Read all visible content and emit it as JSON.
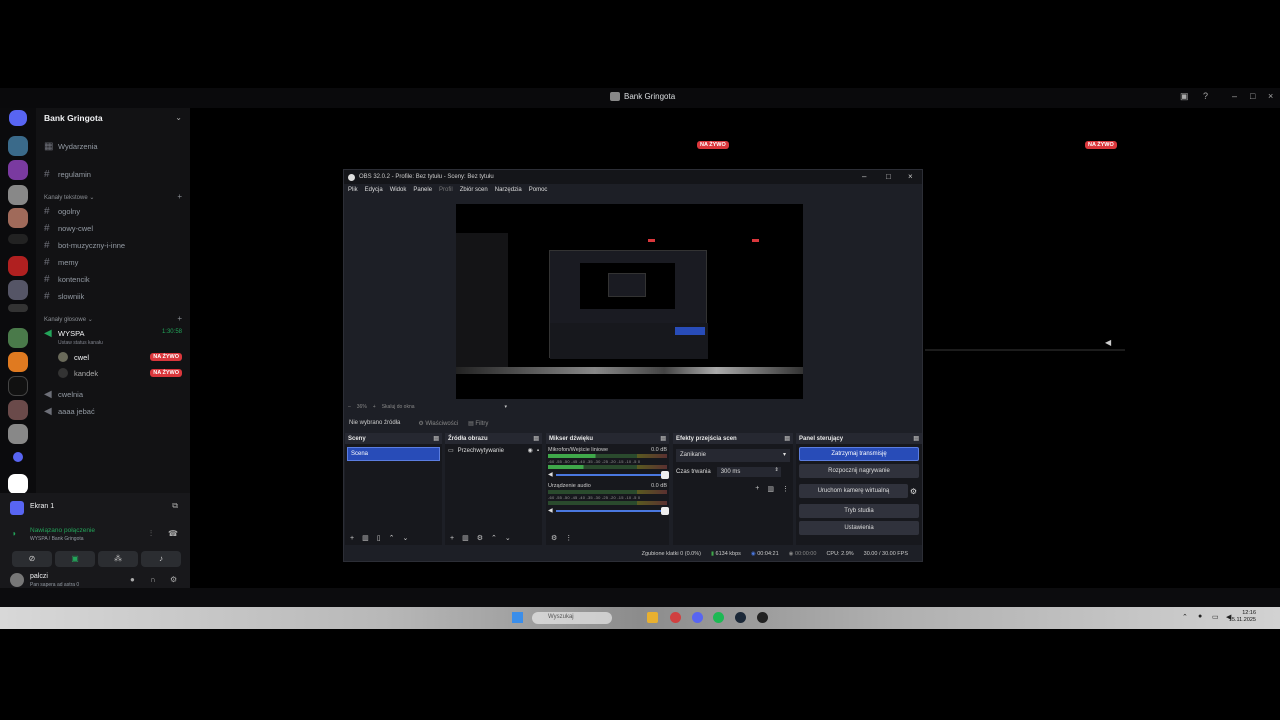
{
  "window": {
    "title": "Bank Gringota"
  },
  "discord": {
    "guild_name": "Bank Gringota",
    "events": "Wydarzenia",
    "channels_top": [
      {
        "name": "regulamin"
      }
    ],
    "text_category": "Kanały tekstowe",
    "text_channels": [
      {
        "name": "ogolny"
      },
      {
        "name": "nowy-cwel"
      },
      {
        "name": "bot-muzyczny-i-inne"
      },
      {
        "name": "memy"
      },
      {
        "name": "kontencik"
      },
      {
        "name": "slowniik"
      }
    ],
    "voice_category": "Kanały głosowe",
    "voice_active": {
      "name": "WYSPA",
      "timer": "1:30:58",
      "status": "Ustaw status kanału"
    },
    "voice_members": [
      {
        "name": "cwel",
        "badge": "NA ŻYWO"
      },
      {
        "name": "kandek",
        "badge": "NA ŻYWO"
      }
    ],
    "voice_channels": [
      {
        "name": "cwelnia"
      },
      {
        "name": "aaaa jebać"
      }
    ],
    "screen_share": "Ekran 1",
    "connection": {
      "status": "Nawiązano połączenie",
      "detail": "WYSPA / Bank Gringota"
    },
    "user": {
      "name": "palczi",
      "status": "Pan sapera ad astra 0"
    },
    "stream_badges": [
      "NA ŻYWO",
      "NA ŻYWO"
    ]
  },
  "obs": {
    "title": "OBS 32.0.2 - Profile: Bez tytułu - Sceny: Bez tytułu",
    "menu": [
      "Plik",
      "Edycja",
      "Widok",
      "Panele",
      "Profil",
      "Zbiór scen",
      "Narzędzia",
      "Pomoc"
    ],
    "zoom": "36%",
    "zoom_fit": "Skaluj do okna",
    "no_source": "Nie wybrano źródła",
    "properties": "Właściwości",
    "filters": "Filtry",
    "docks": {
      "scenes": {
        "title": "Sceny",
        "items": [
          "Scena"
        ]
      },
      "sources": {
        "title": "Źródła obrazu",
        "items": [
          "Przechwytywanie"
        ]
      },
      "mixer": {
        "title": "Mikser dźwięku",
        "channels": [
          {
            "name": "Mikrofon/Wejście liniowe",
            "db": "0.0 dB"
          },
          {
            "name": "Urządzenie audio",
            "db": "0.0 dB"
          }
        ],
        "ticks": "-60 -55 -50 -45 -40 -35 -30 -25 -20 -15 -10 -5 0"
      },
      "transitions": {
        "title": "Efekty przejścia scen",
        "selected": "Zanikanie",
        "duration_label": "Czas trwania",
        "duration": "300 ms"
      },
      "controls": {
        "title": "Panel sterujący",
        "buttons": [
          "Zatrzymaj transmisję",
          "Rozpocznij nagrywanie",
          "Uruchom kamerę wirtualną",
          "Tryb studia",
          "Ustawienia"
        ]
      }
    },
    "status": {
      "dropped": "Zgubione klatki 0 (0.0%)",
      "bitrate": "6134 kbps",
      "live_time": "00:04:21",
      "rec_time": "00:00:00",
      "cpu": "CPU: 2.9%",
      "fps": "30.00 / 30.00 FPS"
    }
  },
  "taskbar": {
    "search": "Wyszukaj",
    "time": "12:16",
    "date": "15.11.2025"
  },
  "colors": {
    "live": "#da373c",
    "accent": "#284cb8",
    "connected": "#23a55a"
  }
}
